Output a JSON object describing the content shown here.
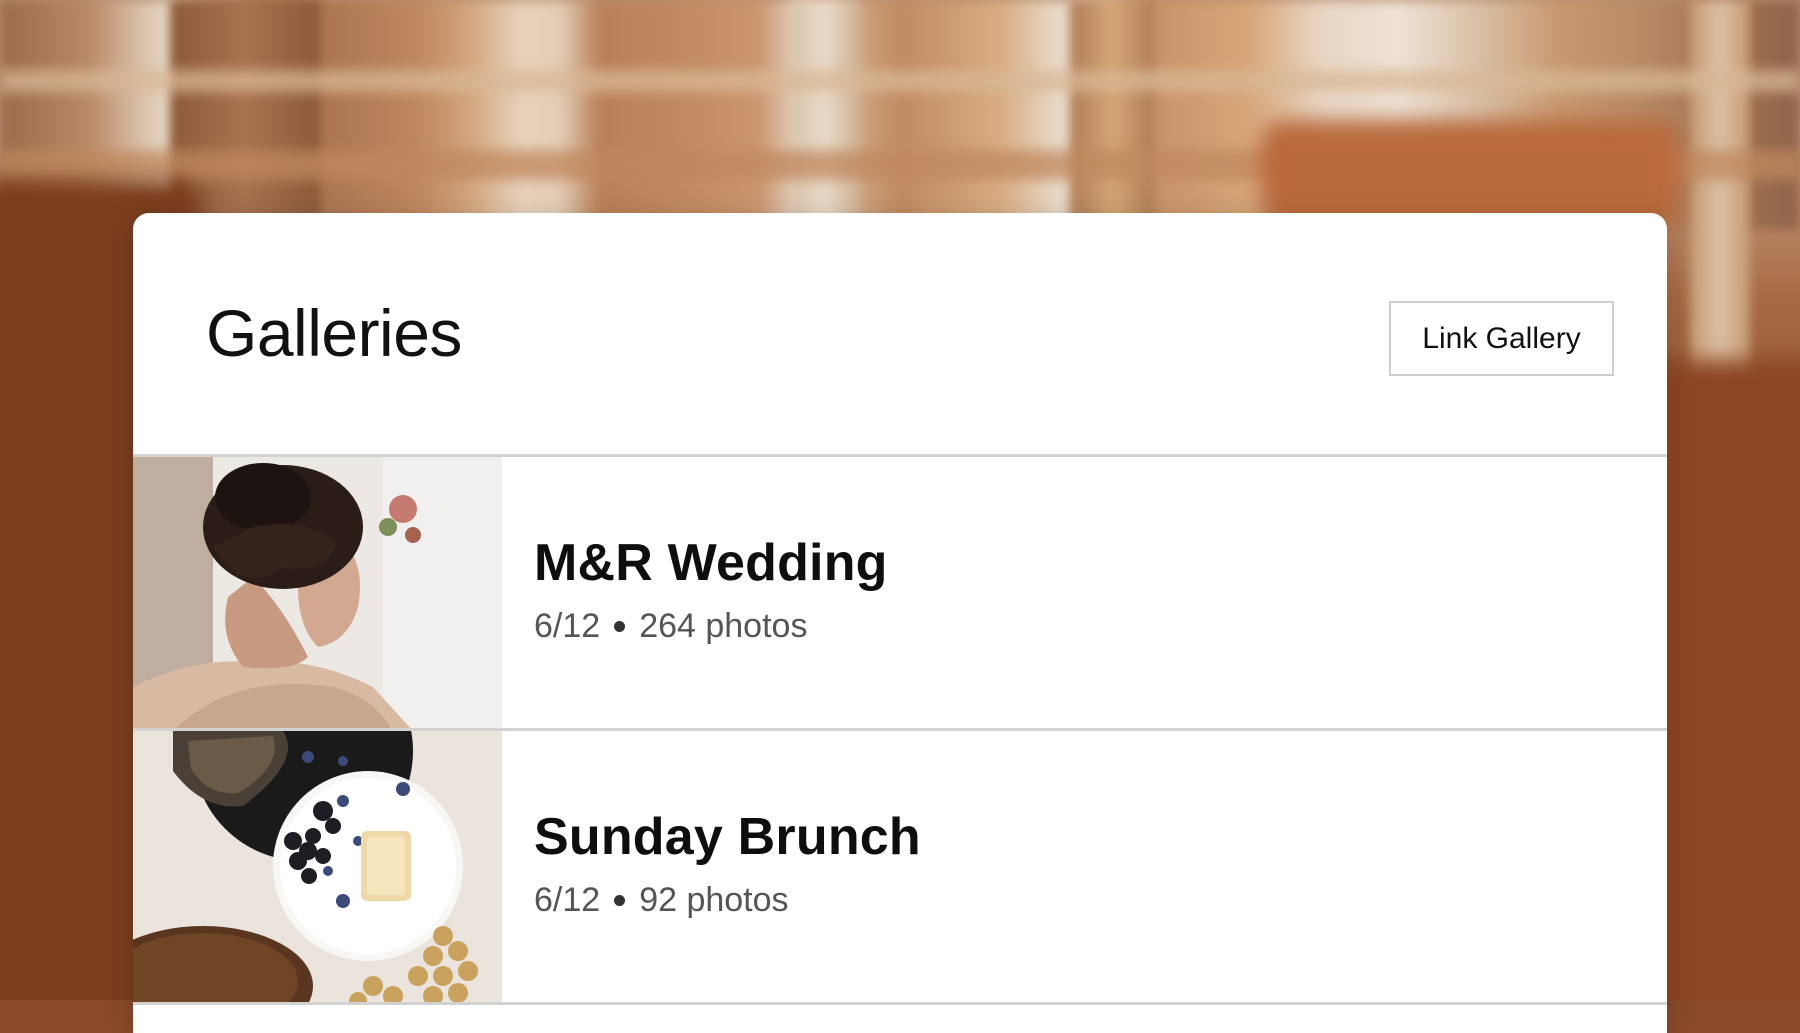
{
  "header": {
    "title": "Galleries",
    "link_gallery_label": "Link Gallery"
  },
  "galleries": [
    {
      "name": "M&R Wedding",
      "date": "6/12",
      "photos": "264 photos",
      "thumbnail": "bride-portrait"
    },
    {
      "name": "Sunday Brunch",
      "date": "6/12",
      "photos": "92 photos",
      "thumbnail": "brunch-table"
    }
  ],
  "colors": {
    "card_background": "#ffffff",
    "divider": "#d2d2d2",
    "title_text": "#111111",
    "meta_text": "#555555"
  }
}
